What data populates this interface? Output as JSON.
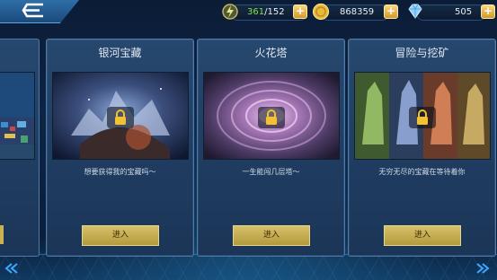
{
  "resources": {
    "stamina": {
      "current": "361",
      "max": "/152",
      "icon": "energy-icon"
    },
    "gold": {
      "value": "868359",
      "icon": "coin-icon"
    },
    "diamond": {
      "value": "505",
      "icon": "diamond-icon"
    },
    "plus": "+"
  },
  "cards": [
    {
      "title": "银河宝藏",
      "desc": "想要获得我的宝藏吗～",
      "button": "进入",
      "locked": true
    },
    {
      "title": "火花塔",
      "desc": "一生能闯几层塔～",
      "button": "进入",
      "locked": true
    },
    {
      "title": "冒险与挖矿",
      "desc": "无穷无尽的宝藏在等待着你",
      "button": "进入",
      "locked": true
    }
  ],
  "colors": {
    "accent_green": "#7fe04a",
    "gold": "#e2c266",
    "frame": "#4d7aaa"
  }
}
